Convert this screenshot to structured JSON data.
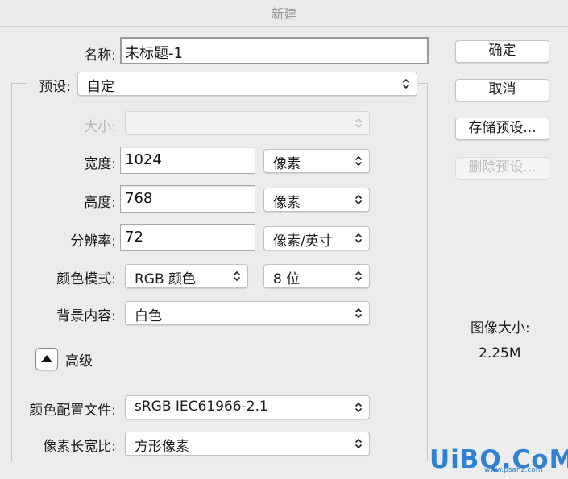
{
  "window": {
    "title": "新建"
  },
  "form": {
    "name_label": "名称:",
    "name_value": "未标题-1",
    "preset_label": "预设:",
    "preset_value": "自定",
    "size_label": "大小:",
    "size_value": "",
    "width_label": "宽度:",
    "width_value": "1024",
    "width_unit": "像素",
    "height_label": "高度:",
    "height_value": "768",
    "height_unit": "像素",
    "resolution_label": "分辨率:",
    "resolution_value": "72",
    "resolution_unit": "像素/英寸",
    "color_mode_label": "颜色模式:",
    "color_mode_value": "RGB 颜色",
    "bit_depth_value": "8 位",
    "background_label": "背景内容:",
    "background_value": "白色",
    "advanced_label": "高级",
    "color_profile_label": "颜色配置文件:",
    "color_profile_value": "sRGB IEC61966-2.1",
    "pixel_aspect_label": "像素长宽比:",
    "pixel_aspect_value": "方形像素"
  },
  "buttons": {
    "ok": "确定",
    "cancel": "取消",
    "save_preset": "存储预设...",
    "delete_preset": "删除预设..."
  },
  "image_size": {
    "label": "图像大小:",
    "value": "2.25M"
  },
  "watermark": {
    "main": "UiBQ.CoM",
    "sub": "www.psahz.com"
  }
}
